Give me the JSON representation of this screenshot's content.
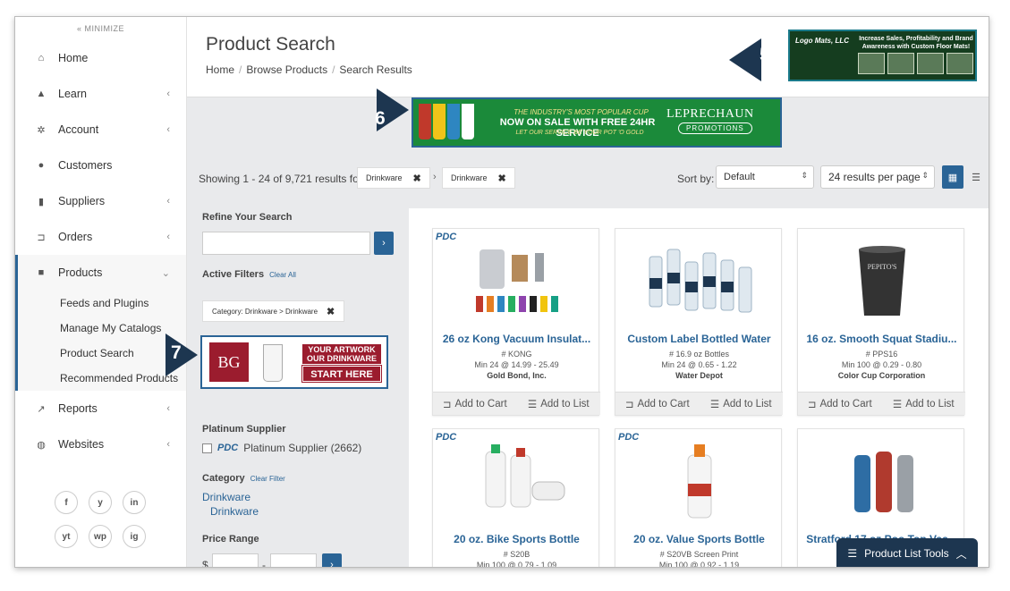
{
  "sidebar": {
    "minimize": "« MINIMIZE",
    "items": [
      {
        "label": "Home",
        "icon": "home-icon"
      },
      {
        "label": "Learn",
        "icon": "graduation-cap-icon"
      },
      {
        "label": "Account",
        "icon": "gear-icon"
      },
      {
        "label": "Customers",
        "icon": "users-icon"
      },
      {
        "label": "Suppliers",
        "icon": "bar-chart-icon"
      },
      {
        "label": "Orders",
        "icon": "cart-icon"
      },
      {
        "label": "Products",
        "icon": "box-icon"
      },
      {
        "label": "Reports",
        "icon": "line-chart-icon"
      },
      {
        "label": "Websites",
        "icon": "globe-icon"
      }
    ],
    "sub_items": [
      "Feeds and Plugins",
      "Manage My Catalogs",
      "Product Search",
      "Recommended Products"
    ],
    "socials": [
      "f",
      "y",
      "in",
      "yt",
      "wp",
      "ig"
    ]
  },
  "header": {
    "title": "Product Search",
    "breadcrumb": [
      "Home",
      "Browse Products",
      "Search Results"
    ]
  },
  "ads": {
    "ad5": {
      "brand": "Logo Mats, LLC",
      "headline": "Increase Sales, Profitability and Brand Awareness with Custom Floor Mats!"
    },
    "ad6": {
      "line1": "THE INDUSTRY'S MOST POPULAR CUP",
      "line2": "NOW ON SALE WITH FREE 24HR SERVICE",
      "line3": "LET OUR SERVICE BE YOUR POT 'O GOLD",
      "brand": "LEPRECHAUN",
      "brand_sub": "PROMOTIONS"
    },
    "ad7": {
      "logo": "BG",
      "line1": "YOUR ARTWORK OUR DRINKWARE",
      "line2": "START HERE"
    }
  },
  "callouts": {
    "c5": "5",
    "c6": "6",
    "c7": "7"
  },
  "results": {
    "showing": "Showing 1 - 24 of 9,721 results for",
    "chip1": "Drinkware",
    "chip2": "Drinkware",
    "sort_label": "Sort by:",
    "sort_value": "Default",
    "per_page": "24 results per page"
  },
  "refine": {
    "heading": "Refine Your Search",
    "active_filters": "Active Filters",
    "clear_all": "Clear All",
    "filter_chip": "Category: Drinkware > Drinkware",
    "platinum_heading": "Platinum Supplier",
    "pdc": "PDC",
    "platinum_label": "Platinum Supplier (2662)",
    "category_heading": "Category",
    "clear_filter": "Clear Filter",
    "cat1": "Drinkware",
    "cat2": "Drinkware",
    "price_heading": "Price Range",
    "currency": "$",
    "dash": "-"
  },
  "products": [
    {
      "title": "26 oz Kong Vacuum Insulat...",
      "sku": "# KONG",
      "min": "Min 24 @ 14.99 - 25.49",
      "supplier": "Gold Bond, Inc.",
      "badge": "PDC"
    },
    {
      "title": "Custom Label Bottled Water",
      "sku": "# 16.9 oz Bottles",
      "min": "Min 24 @ 0.65 - 1.22",
      "supplier": "Water Depot",
      "badge": ""
    },
    {
      "title": "16 oz. Smooth Squat Stadiu...",
      "sku": "# PPS16",
      "min": "Min 100 @ 0.29 - 0.80",
      "supplier": "Color Cup Corporation",
      "badge": ""
    },
    {
      "title": "20 oz. Bike Sports Bottle",
      "sku": "# S20B",
      "min": "Min 100 @ 0.79 - 1.09",
      "supplier": "",
      "badge": "PDC"
    },
    {
      "title": "20 oz. Value Sports Bottle",
      "sku": "# S20VB Screen Print",
      "min": "Min 100 @ 0.92 - 1.19",
      "supplier": "",
      "badge": "PDC"
    },
    {
      "title": "Stratford 17 oz Poo Top Vac...",
      "sku": "",
      "min": "",
      "supplier": "",
      "badge": ""
    }
  ],
  "card_actions": {
    "add_cart": "Add to Cart",
    "add_list": "Add to List"
  },
  "tools": {
    "label": "Product List Tools"
  }
}
